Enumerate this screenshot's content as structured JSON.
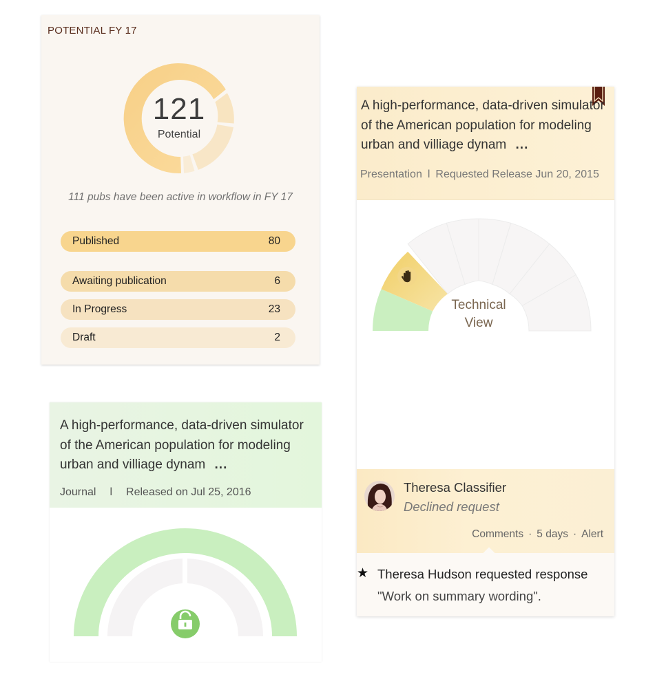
{
  "potential_card": {
    "title": "POTENTIAL FY 17",
    "total": "121",
    "total_label": "Potential",
    "active_note": "111 pubs have been active in workflow in FY 17",
    "rows": [
      {
        "label": "Published",
        "count": "80",
        "color": "#f8d58e"
      },
      {
        "label": "Awaiting publication",
        "count": "6",
        "color": "#f5dcab"
      },
      {
        "label": "In Progress",
        "count": "23",
        "color": "#f6e2c0"
      },
      {
        "label": "Draft",
        "count": "2",
        "color": "#f8ead3"
      }
    ]
  },
  "journal_card": {
    "description": "A high-performance, data-driven simulator of the American population for modeling urban and villiage dynam",
    "more": "...",
    "type": "Journal",
    "separator": "l",
    "release": "Released on Jul 25, 2016",
    "lock_icon": "unlock-icon",
    "accent": "#c9efbf"
  },
  "presentation_card": {
    "description": "A high-performance, data-driven simulator of the American population for modeling urban and villiage dynam",
    "more": "...",
    "type": "Presentation",
    "separator": "l",
    "release": "Requested Release Jun 20, 2015",
    "bookmark_icon": "bookmark-icon",
    "gauge_label_line1": "Technical",
    "gauge_label_line2": "View",
    "gauge_icon": "hand-stop-icon",
    "reviewer": {
      "name": "Theresa Classifier",
      "status": "Declined request",
      "actions": [
        "Comments",
        "5 days",
        "Alert"
      ]
    },
    "response": {
      "title": "Theresa Hudson requested response",
      "quote": "\"Work on summary wording\"."
    }
  }
}
